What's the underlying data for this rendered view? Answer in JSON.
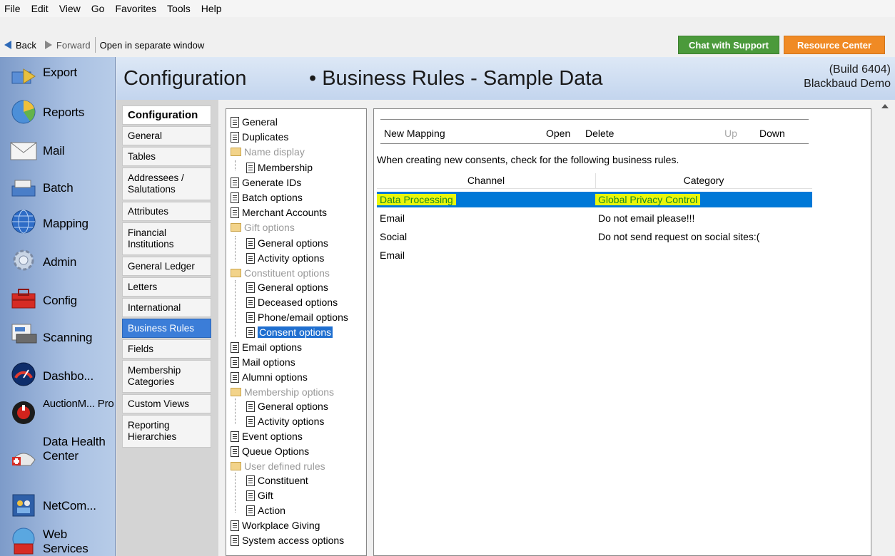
{
  "menu": [
    "File",
    "Edit",
    "View",
    "Go",
    "Favorites",
    "Tools",
    "Help"
  ],
  "toolbar": {
    "back": "Back",
    "forward": "Forward",
    "open_separate": "Open in separate window",
    "chat": "Chat with Support",
    "resource": "Resource Center"
  },
  "sidebar": [
    {
      "label": "Export",
      "icon": "export-icon"
    },
    {
      "label": "Reports",
      "icon": "reports-icon"
    },
    {
      "label": "Mail",
      "icon": "mail-icon"
    },
    {
      "label": "Batch",
      "icon": "batch-icon"
    },
    {
      "label": "Mapping",
      "icon": "globe-icon"
    },
    {
      "label": "Admin",
      "icon": "gear-icon"
    },
    {
      "label": "Config",
      "icon": "toolbox-icon"
    },
    {
      "label": "Scanning",
      "icon": "scanner-icon"
    },
    {
      "label": "Dashbo...",
      "icon": "dashboard-icon"
    },
    {
      "label": "AuctionM... Pro",
      "icon": "auction-icon"
    },
    {
      "label": "Data Health Center",
      "icon": "health-icon"
    },
    {
      "label": "NetCom...",
      "icon": "netcommunity-icon"
    },
    {
      "label": "Web Services",
      "icon": "web-services-icon"
    }
  ],
  "header": {
    "title": "Configuration",
    "subtitle": "• Business Rules - Sample Data",
    "build": "(Build 6404)",
    "org": "Blackbaud Demo"
  },
  "config_nav": [
    "Configuration",
    "General",
    "Tables",
    "Addressees / Salutations",
    "Attributes",
    "Financial Institutions",
    "General Ledger",
    "Letters",
    "International",
    "Business Rules",
    "Fields",
    "Membership Categories",
    "Custom Views",
    "Reporting Hierarchies"
  ],
  "tree": [
    "General",
    "Duplicates",
    "Name display",
    "Membership",
    "Generate IDs",
    "Batch options",
    "Merchant Accounts",
    "Gift options",
    "General options",
    "Activity options",
    "Constituent options",
    "General options",
    "Deceased options",
    "Phone/email options",
    "Consent options",
    "Email options",
    "Mail options",
    "Alumni options",
    "Membership options",
    "General options",
    "Activity options",
    "Event options",
    "Queue Options",
    "User defined rules",
    "Constituent",
    "Gift",
    "Action",
    "Workplace Giving",
    "System access options"
  ],
  "panel": {
    "tools": {
      "new_mapping": "New Mapping",
      "open": "Open",
      "delete": "Delete",
      "up": "Up",
      "down": "Down"
    },
    "description": "When creating new consents, check for the following business rules.",
    "columns": [
      "Channel",
      "Category"
    ],
    "rows": [
      {
        "channel": "Data Processing",
        "category": "Global Privacy Control"
      },
      {
        "channel": "Email",
        "category": "Do not email please!!!"
      },
      {
        "channel": "Social",
        "category": "Do not send request on social sites:("
      },
      {
        "channel": "Email",
        "category": ""
      }
    ]
  }
}
